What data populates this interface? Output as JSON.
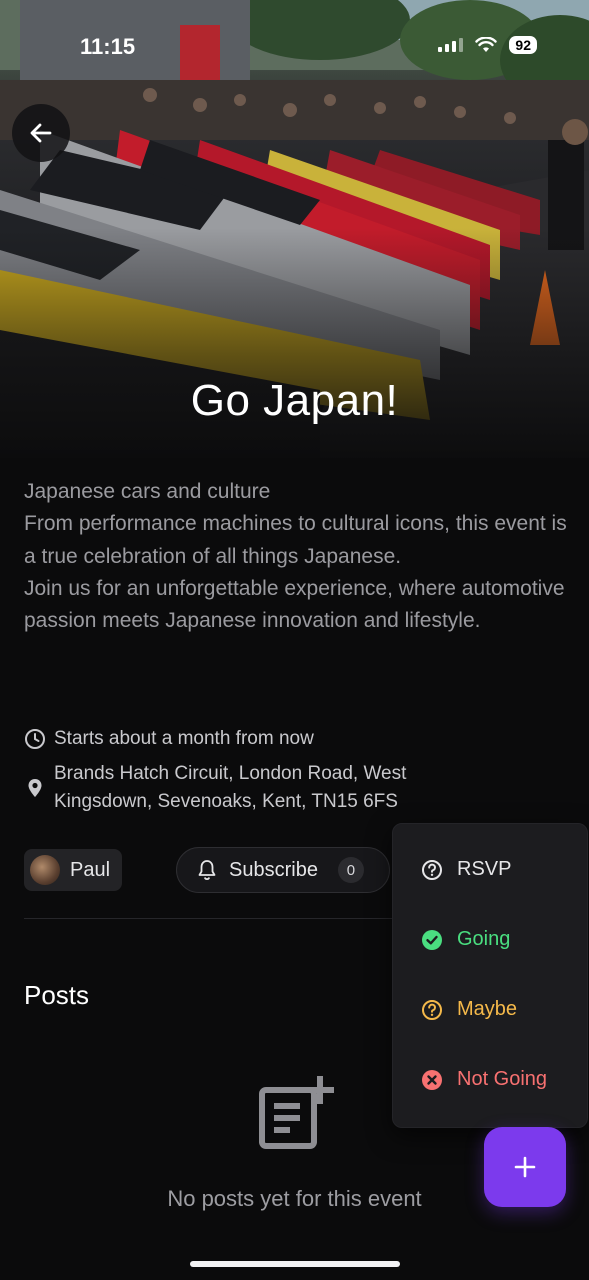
{
  "status_bar": {
    "time": "11:15",
    "battery": "92"
  },
  "event": {
    "title": "Go Japan!",
    "description": "Japanese cars and culture\nFrom performance machines to cultural icons, this event is a true celebration of all things Japanese.\nJoin us for an unforgettable experience, where automotive passion meets Japanese innovation and lifestyle.",
    "start": "Starts about a month from now",
    "location": "Brands Hatch Circuit, London Road, West\nKingsdown, Sevenoaks, Kent, TN15 6FS"
  },
  "host": {
    "name": "Paul"
  },
  "subscribe": {
    "label": "Subscribe",
    "count": "0"
  },
  "posts": {
    "title": "Posts",
    "empty_message": "No posts yet for this event"
  },
  "rsvp_menu": {
    "items": [
      {
        "label": "RSVP",
        "color": "#e6e6e8",
        "icon": "question-circle-icon"
      },
      {
        "label": "Going",
        "color": "#4ade80",
        "icon": "check-circle-icon"
      },
      {
        "label": "Maybe",
        "color": "#f5b94a",
        "icon": "question-circle-icon"
      },
      {
        "label": "Not Going",
        "color": "#f87171",
        "icon": "x-circle-icon"
      }
    ]
  },
  "colors": {
    "accent": "#7c3aed",
    "background": "#0b0b0c"
  }
}
